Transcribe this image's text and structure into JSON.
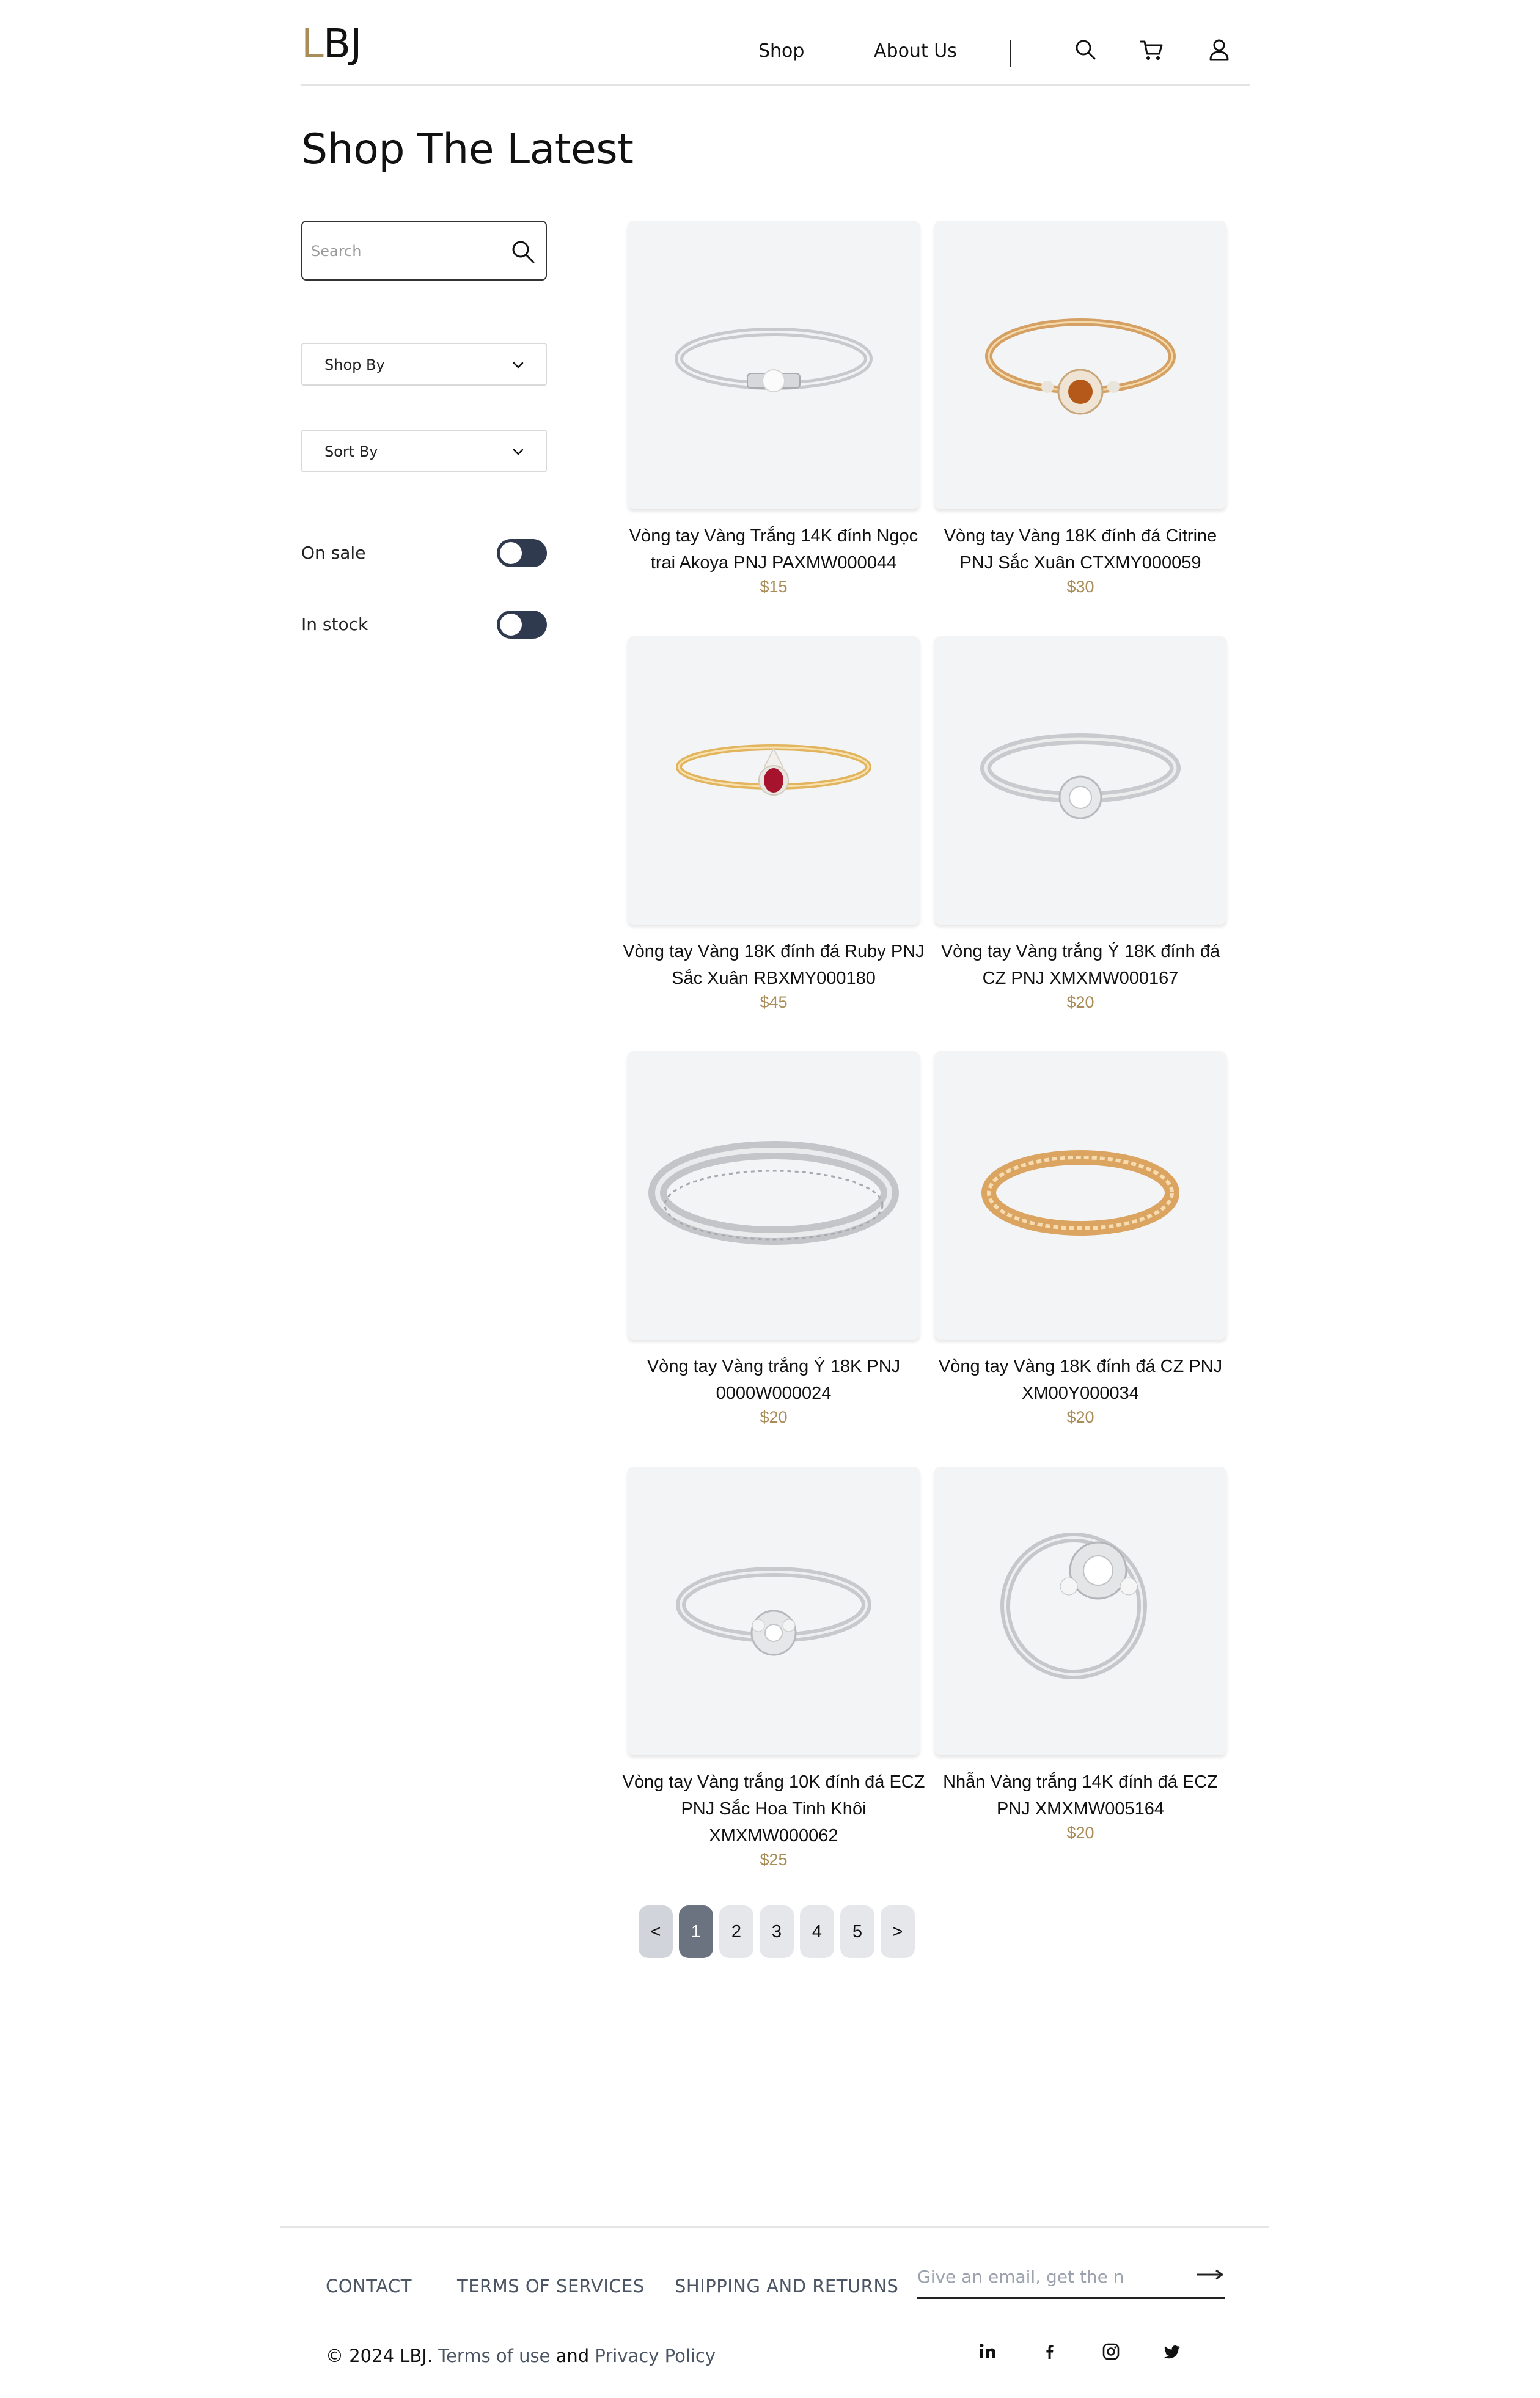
{
  "header": {
    "logo_accent": "L",
    "logo_rest": "BJ",
    "nav": {
      "shop": "Shop",
      "about": "About Us"
    },
    "icons": [
      "search-icon",
      "cart-icon",
      "user-icon"
    ]
  },
  "page_title": "Shop The Latest",
  "sidebar": {
    "search_placeholder": "Search",
    "shop_by": "Shop By",
    "sort_by": "Sort By",
    "on_sale": "On sale",
    "in_stock": "In stock"
  },
  "products": [
    {
      "name": "Vòng tay Vàng Trắng 14K đính Ngọc trai Akoya PNJ PAXMW000044",
      "price": "$15"
    },
    {
      "name": "Vòng tay Vàng 18K đính đá Citrine PNJ Sắc Xuân CTXMY000059",
      "price": "$30"
    },
    {
      "name": "Vòng tay Vàng 18K đính đá Ruby PNJ Sắc Xuân RBXMY000180",
      "price": "$45"
    },
    {
      "name": "Vòng tay Vàng trắng Ý 18K đính đá CZ PNJ XMXMW000167",
      "price": "$20"
    },
    {
      "name": "Vòng tay Vàng trắng Ý 18K PNJ 0000W000024",
      "price": "$20"
    },
    {
      "name": "Vòng tay Vàng 18K đính đá CZ PNJ XM00Y000034",
      "price": "$20"
    },
    {
      "name": "Vòng tay Vàng trắng 10K đính đá ECZ PNJ Sắc Hoa Tinh Khôi XMXMW000062",
      "price": "$25"
    },
    {
      "name": "Nhẫn Vàng trắng 14K đính đá ECZ PNJ XMXMW005164",
      "price": "$20"
    }
  ],
  "pagination": {
    "prev": "<",
    "pages": [
      "1",
      "2",
      "3",
      "4",
      "5"
    ],
    "next": ">",
    "current": "1"
  },
  "footer": {
    "links": {
      "contact": "CONTACT",
      "terms": "TERMS OF SERVICES",
      "shipping": "SHIPPING AND RETURNS"
    },
    "email_placeholder": "Give an email, get the n",
    "copyright_prefix": "© 2024 LBJ.",
    "terms_of_use": "Terms of use",
    "and": "and",
    "privacy": "Privacy Policy",
    "social_icons": [
      "linkedin-icon",
      "facebook-icon",
      "instagram-icon",
      "twitter-icon"
    ]
  },
  "colors": {
    "accent": "#a98c57",
    "toggle": "#2f3a4e",
    "card_bg": "#f3f4f6",
    "pager_active": "#6b7280",
    "pager_bg": "#e5e7eb"
  }
}
